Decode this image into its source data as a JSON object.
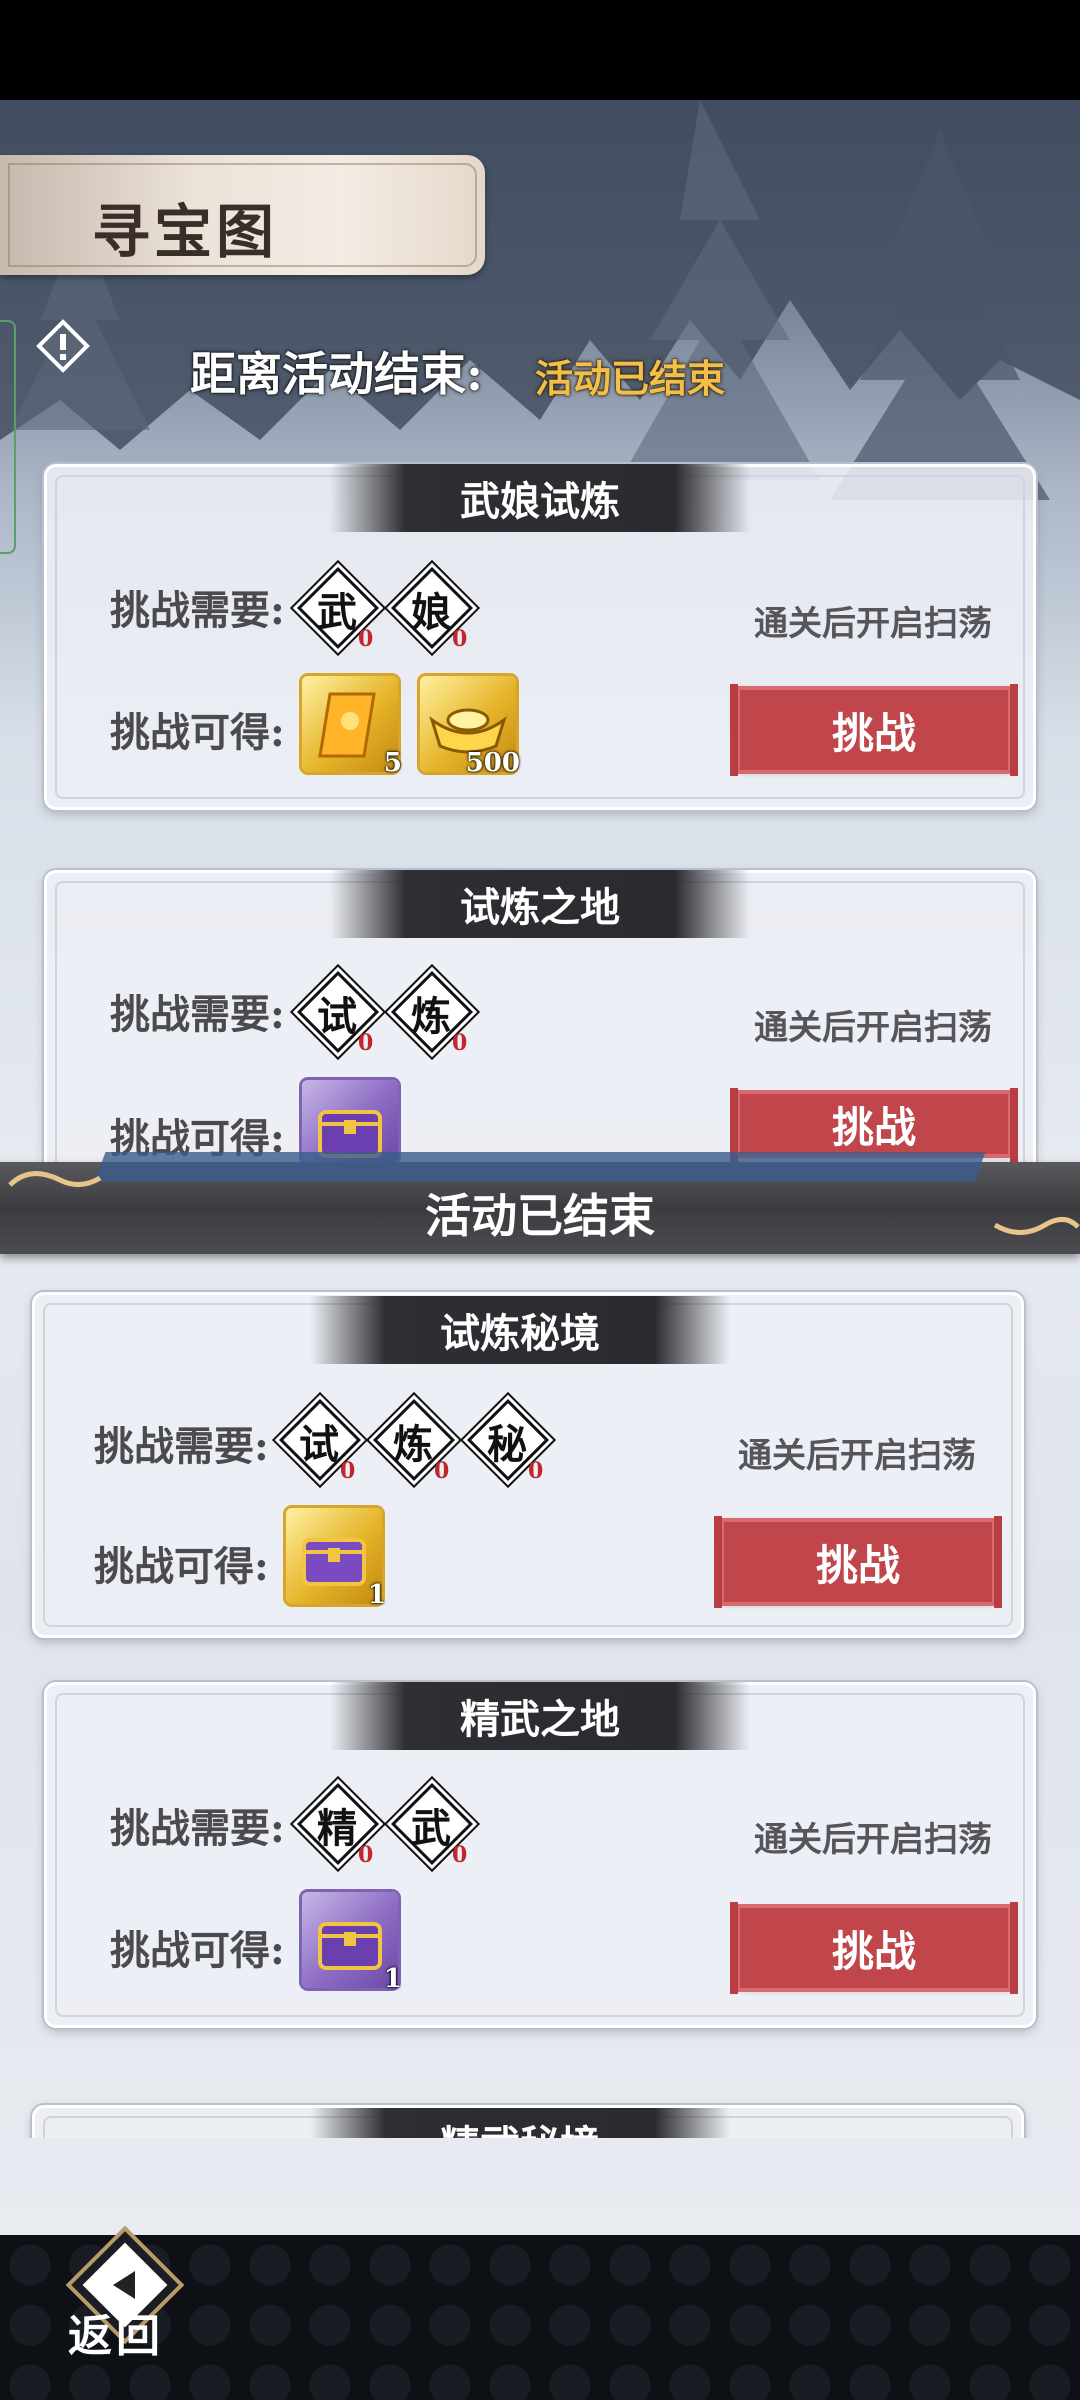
{
  "header": {
    "title": "寻宝图",
    "countdown_label": "距离活动结束:",
    "countdown_value": "活动已结束"
  },
  "ended_banner": "活动已结束",
  "cards": [
    {
      "title": "武娘试炼",
      "require_label": "挑战需要:",
      "reward_label": "挑战可得:",
      "tokens": [
        {
          "char": "武",
          "count": "0"
        },
        {
          "char": "娘",
          "count": "0"
        }
      ],
      "rewards": [
        {
          "icon": "scroll-icon",
          "count": "5",
          "style": "gold"
        },
        {
          "icon": "gold-ingot-icon",
          "count": "500",
          "style": "gold"
        }
      ],
      "sweep_text": "通关后开启扫荡",
      "button": "挑战"
    },
    {
      "title": "试炼之地",
      "require_label": "挑战需要:",
      "reward_label": "挑战可得:",
      "tokens": [
        {
          "char": "试",
          "count": "0"
        },
        {
          "char": "炼",
          "count": "0"
        }
      ],
      "rewards": [
        {
          "icon": "treasure-chest-icon",
          "count": "",
          "style": "purple"
        }
      ],
      "sweep_text": "通关后开启扫荡",
      "button": "挑战"
    },
    {
      "title": "试炼秘境",
      "require_label": "挑战需要:",
      "reward_label": "挑战可得:",
      "tokens": [
        {
          "char": "试",
          "count": "0"
        },
        {
          "char": "炼",
          "count": "0"
        },
        {
          "char": "秘",
          "count": "0"
        }
      ],
      "rewards": [
        {
          "icon": "treasure-chest-icon",
          "count": "1",
          "style": "gold"
        }
      ],
      "sweep_text": "通关后开启扫荡",
      "button": "挑战"
    },
    {
      "title": "精武之地",
      "require_label": "挑战需要:",
      "reward_label": "挑战可得:",
      "tokens": [
        {
          "char": "精",
          "count": "0"
        },
        {
          "char": "武",
          "count": "0"
        }
      ],
      "rewards": [
        {
          "icon": "treasure-chest-icon",
          "count": "1",
          "style": "purple"
        }
      ],
      "sweep_text": "通关后开启扫荡",
      "button": "挑战"
    },
    {
      "title": "精武秘境"
    }
  ],
  "footer": {
    "back_label": "返回"
  }
}
